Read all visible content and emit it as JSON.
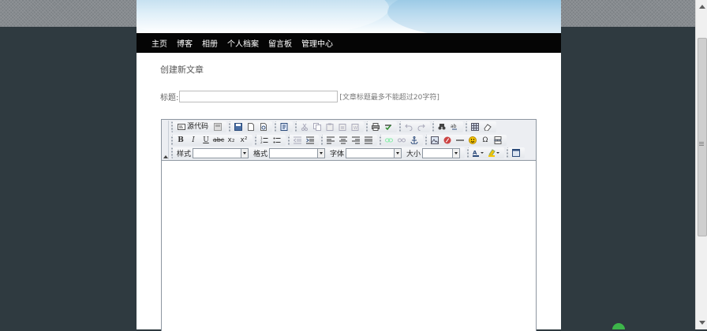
{
  "nav": {
    "items": [
      "主页",
      "博客",
      "相册",
      "个人档案",
      "留言板",
      "管理中心"
    ]
  },
  "page": {
    "title": "创建新文章"
  },
  "form": {
    "title_label": "标题:",
    "title_value": "",
    "title_hint": "[文章标题最多不能超过20字符]"
  },
  "toolbar": {
    "source_label": "源代码",
    "subscript_glyph": "x₂",
    "superscript_glyph": "x²",
    "style_label": "样式",
    "format_label": "格式",
    "font_label": "字体",
    "size_label": "大小",
    "bold_glyph": "B",
    "italic_glyph": "I",
    "underline_glyph": "U",
    "strike_glyph": "abc",
    "omega_glyph": "Ω"
  },
  "colors": {
    "nav_bg": "#050505",
    "page_bg": "#ffffff",
    "outer_bg": "#2f3a40"
  }
}
